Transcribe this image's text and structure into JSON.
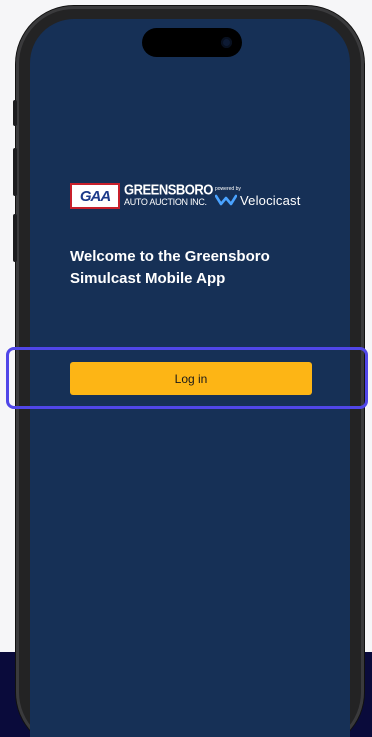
{
  "logo": {
    "badge_letters": "GAA",
    "company_line1": "GREENSBORO",
    "company_line2": "AUTO AUCTION INC.",
    "powered_by": "powered by",
    "partner_name": "Velocicast"
  },
  "welcome": {
    "line1": "Welcome to the Greensboro",
    "line2": "Simulcast Mobile App"
  },
  "actions": {
    "login_label": "Log in"
  },
  "colors": {
    "screen_background": "#163056",
    "login_button": "#fdb515",
    "highlight_outline": "#5046e8",
    "bottom_band": "#0a0b3b"
  }
}
